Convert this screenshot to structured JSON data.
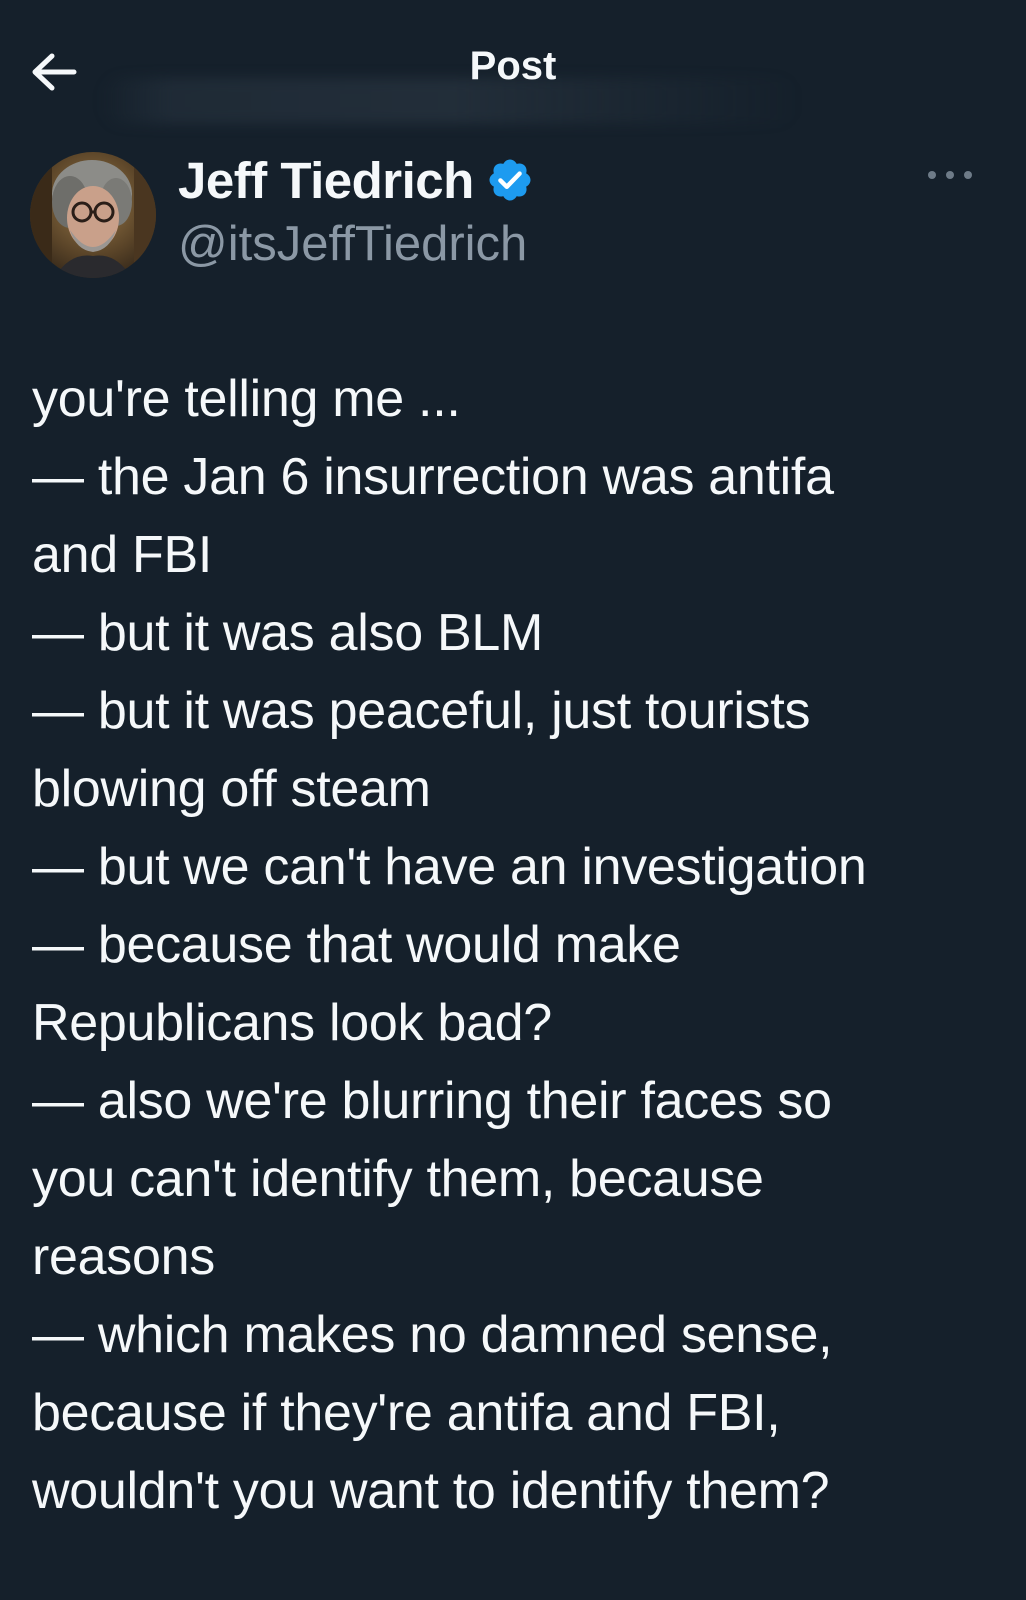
{
  "header": {
    "title": "Post",
    "back_icon": "arrow-left-icon"
  },
  "author": {
    "display_name": "Jeff Tiedrich",
    "handle": "@itsJeffTiedrich",
    "verified_icon": "verified-badge-icon",
    "verified_color": "#1d9bf0"
  },
  "post": {
    "lines": [
      "you're telling me ...",
      "— the Jan 6 insurrection was antifa",
      "and FBI",
      "— but it was also BLM",
      "— but it was peaceful, just tourists",
      "blowing off steam",
      "— but we can't have an investigation",
      "— because that would make",
      "Republicans look bad?",
      "— also we're blurring their faces so",
      "you can't identify them, because",
      "reasons",
      "— which makes no damned sense,",
      "because if they're antifa and FBI,",
      "wouldn't you want to identify them?"
    ]
  },
  "colors": {
    "background": "#15202b",
    "text": "#f5f8fa",
    "secondary_text": "#8b98a5",
    "accent": "#1d9bf0"
  }
}
